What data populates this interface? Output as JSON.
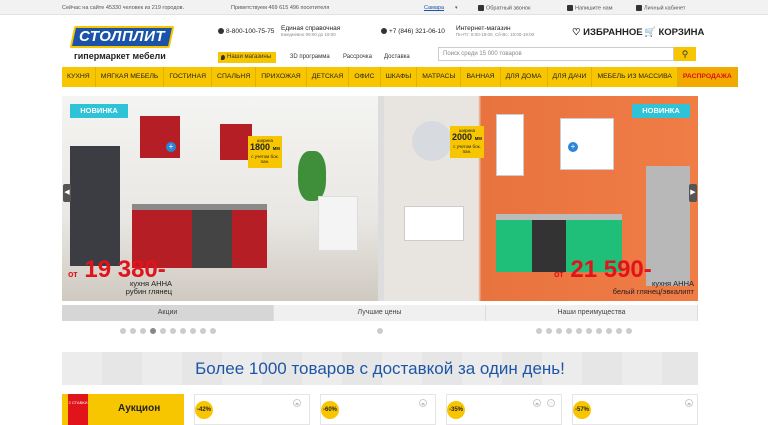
{
  "topbar": {
    "online": "Сейчас на сайте 45330 человек из 219 городов.",
    "greeting": "Приветствуем 469 615 496 посетителя",
    "city": "Самара",
    "callback": "Обратный звонок",
    "write_us": "Напишите нам",
    "account": "Личный кабинет"
  },
  "logo": {
    "name": "СТОЛПЛИТ",
    "subtitle": "гипермаркет мебели"
  },
  "header": {
    "phone1": "8-800-100-75-75",
    "phone1_label": "Единая справочная",
    "phone1_hours": "Ежедневно 09:00 до 19:00",
    "phone2": "+7 (846) 321-06-10",
    "phone2_label": "Интернет-магазин",
    "phone2_hours": "Пн-Пт: 8:00-19:00, Сб-Вс: 10:00-19:00",
    "shops_btn": "Наши магазины",
    "link_3d": "3D программа",
    "link_credit": "Рассрочка",
    "link_delivery": "Доставка",
    "favorites": "ИЗБРАННОЕ",
    "cart": "КОРЗИНА",
    "search_placeholder": "Поиск среди 15 000 товаров"
  },
  "nav": [
    "КУХНЯ",
    "МЯГКАЯ МЕБЕЛЬ",
    "ГОСТИНАЯ",
    "СПАЛЬНЯ",
    "ПРИХОЖАЯ",
    "ДЕТСКАЯ",
    "ОФИС",
    "ШКАФЫ",
    "МАТРАСЫ",
    "ВАННАЯ",
    "ДЛЯ ДОМА",
    "ДЛЯ ДАЧИ",
    "МЕБЕЛЬ ИЗ МАССИВА",
    "РАСПРОДАЖА"
  ],
  "slides": [
    {
      "badge": "НОВИНКА",
      "prefix": "от",
      "price": "19 380-",
      "name1": "кухня АННА",
      "name2": "рубин глянец",
      "width_label": "ширина",
      "width": "1800",
      "width_unit": "мм",
      "width_note": "с учетом бок. пан."
    },
    {
      "badge": "НОВИНКА",
      "prefix": "от",
      "price": "21 590-",
      "name1": "кухня АННА",
      "name2": "белый глянец/эвкалипт",
      "width_label": "ширина",
      "width": "2000",
      "width_unit": "мм",
      "width_note": "с учетом бок. пан."
    }
  ],
  "tabs": [
    "Акции",
    "Лучшие цены",
    "Наши преимущества"
  ],
  "banner": "Более 1000 товаров с доставкой за один день!",
  "auction": {
    "label": "Аукцион",
    "tag": "2 СТАВКИ"
  },
  "discounts": [
    "-42%",
    "-60%",
    "-35%",
    "-57%"
  ],
  "colors": {
    "accent": "#f7c600",
    "brand": "#1a53a8",
    "price": "#e0141a",
    "badge": "#2fc3d7"
  }
}
